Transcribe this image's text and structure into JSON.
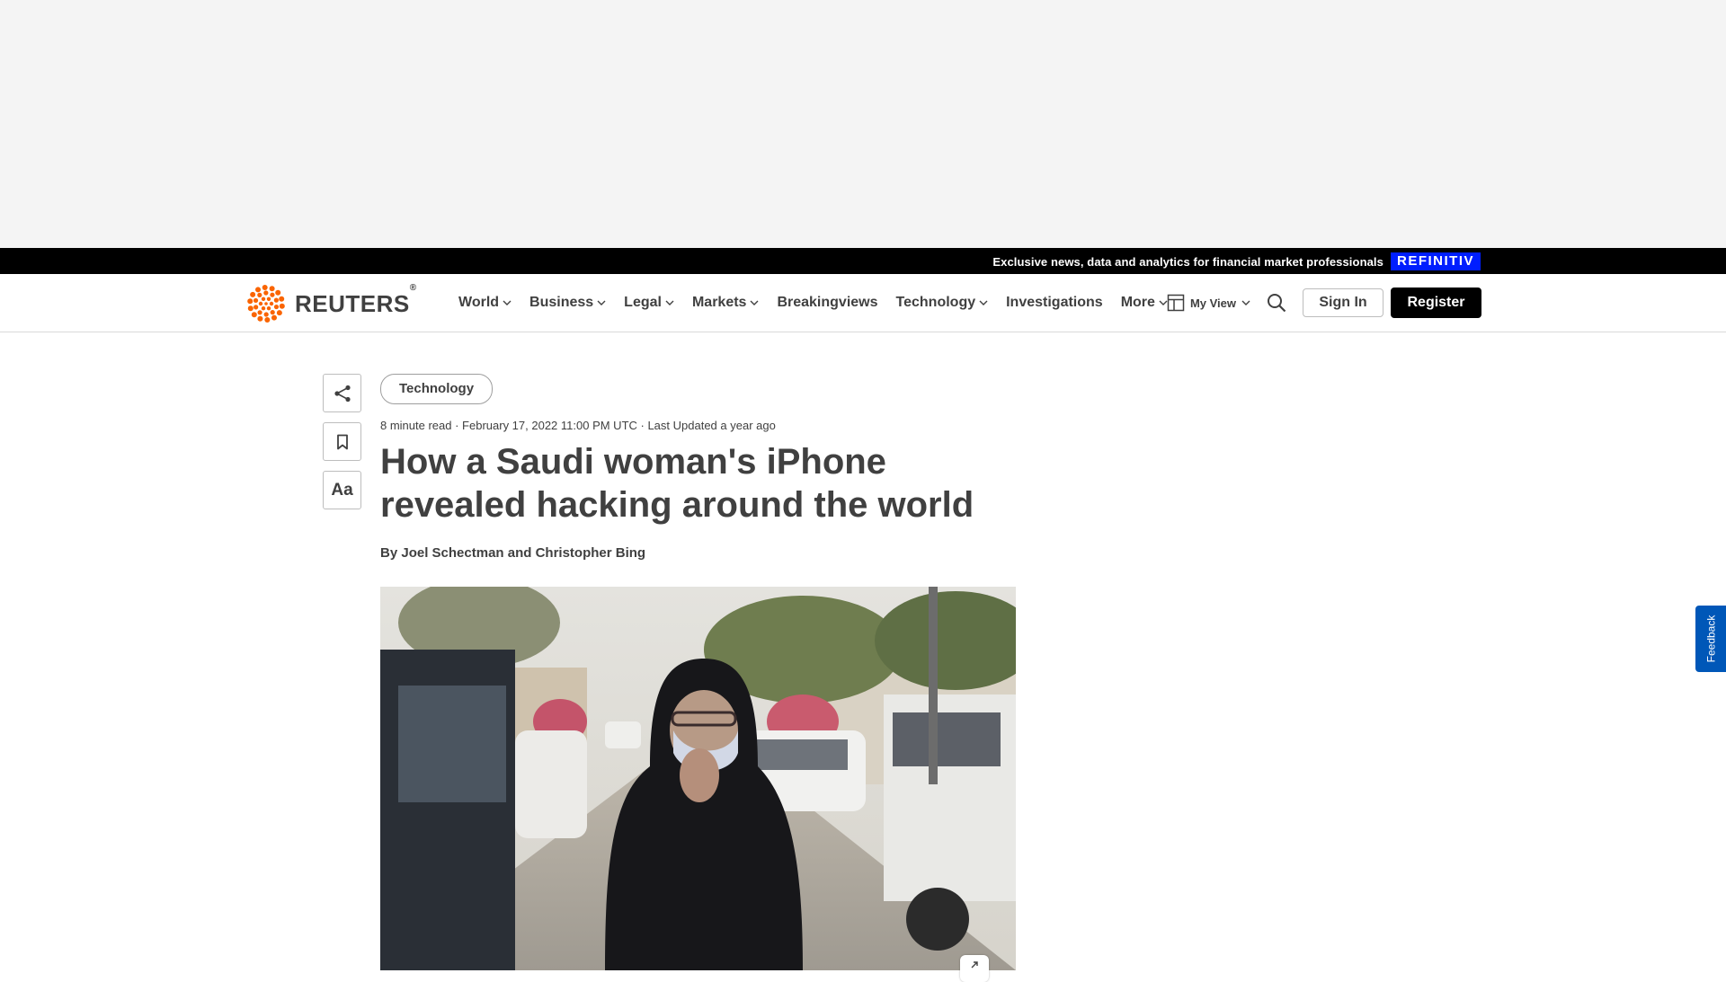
{
  "promo": {
    "text": "Exclusive news, data and analytics for financial market professionals",
    "brand": "REFINITIV"
  },
  "header": {
    "logo_text": "REUTERS",
    "logo_reg": "®",
    "nav": [
      {
        "label": "World",
        "dropdown": true
      },
      {
        "label": "Business",
        "dropdown": true
      },
      {
        "label": "Legal",
        "dropdown": true
      },
      {
        "label": "Markets",
        "dropdown": true
      },
      {
        "label": "Breakingviews",
        "dropdown": false
      },
      {
        "label": "Technology",
        "dropdown": true
      },
      {
        "label": "Investigations",
        "dropdown": false
      },
      {
        "label": "More",
        "dropdown": true
      }
    ],
    "my_view": "My View",
    "sign_in": "Sign In",
    "register": "Register"
  },
  "tools": {
    "text_size_label": "Aa"
  },
  "article": {
    "tag": "Technology",
    "meta": "8 minute read · February 17, 2022 11:00 PM UTC · Last Updated a year ago",
    "headline": "How a Saudi woman's iPhone revealed hacking around the world",
    "byline_prefix": "By",
    "author1": "Joel Schectman",
    "byline_and": "and",
    "author2": "Christopher Bing"
  },
  "feedback": "Feedback",
  "colors": {
    "accent_orange": "#fa6400",
    "refinitiv_blue": "#001eff",
    "feedback_blue": "#0057b8"
  }
}
